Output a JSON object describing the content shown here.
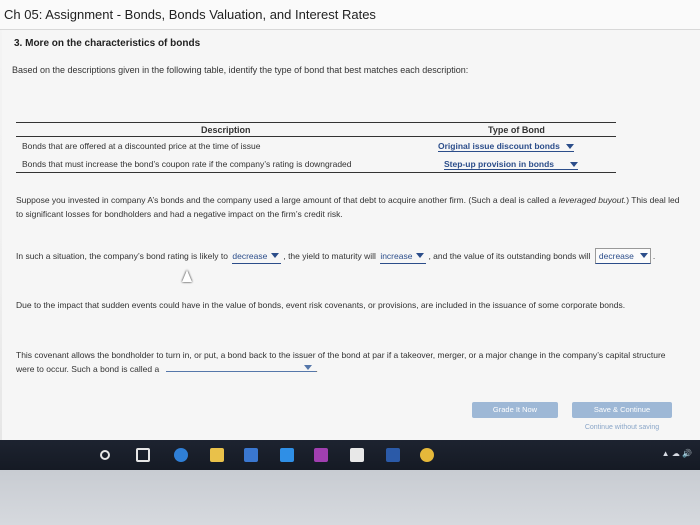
{
  "window": {
    "title": "Ch 05: Assignment - Bonds, Bonds Valuation, and Interest Rates"
  },
  "section": {
    "heading": "3. More on the characteristics of bonds"
  },
  "instruction": "Based on the descriptions given in the following table, identify the type of bond that best matches each description:",
  "table": {
    "headers": {
      "description": "Description",
      "type": "Type of Bond"
    },
    "rows": [
      {
        "description": "Bonds that are offered at a discounted price at the time of issue",
        "selected": "Original issue discount bonds"
      },
      {
        "description": "Bonds that must increase the bond’s coupon rate if the company’s rating is downgraded",
        "selected": "Step-up provision in bonds"
      }
    ]
  },
  "scenario": {
    "text": "Suppose you invested in company A’s bonds and the company used a large amount of that debt to acquire another firm. (Such a deal is called a ",
    "italic": "leveraged buyout.",
    "text_end": ") This deal led to significant losses for bondholders and had a negative impact on the firm’s credit risk."
  },
  "situation": {
    "part1": "In such a situation, the company’s bond rating is likely to",
    "dd1": "decrease",
    "part2": ", the yield to maturity will",
    "dd2": "increase",
    "part3": ", and the value of its outstanding bonds will",
    "dd3": "decrease",
    "part4": "."
  },
  "events": {
    "text": "Due to the impact that sudden events could have in the value of bonds, event risk covenants, or provisions, are included in the issuance of some corporate bonds."
  },
  "covenant": {
    "text": "This covenant allows the bondholder to turn in, or put, a bond back to the issuer of the bond at par if a takeover, merger, or a major change in the company’s capital structure were to occur. Such a bond is called a",
    "end": "."
  },
  "buttons": {
    "grade": "Grade It Now",
    "save": "Save & Continue",
    "continue": "Continue without saving"
  },
  "colors": {
    "link": "#2b4d8a",
    "button": "#9eb8d6",
    "taskbar": "#1d2330"
  },
  "taskbar": {
    "icons": [
      "search-icon",
      "task-view-icon",
      "edge-icon",
      "file-explorer-icon",
      "store-icon",
      "dropbox-icon",
      "onenote-icon",
      "mail-icon",
      "word-icon",
      "chrome-icon"
    ]
  }
}
